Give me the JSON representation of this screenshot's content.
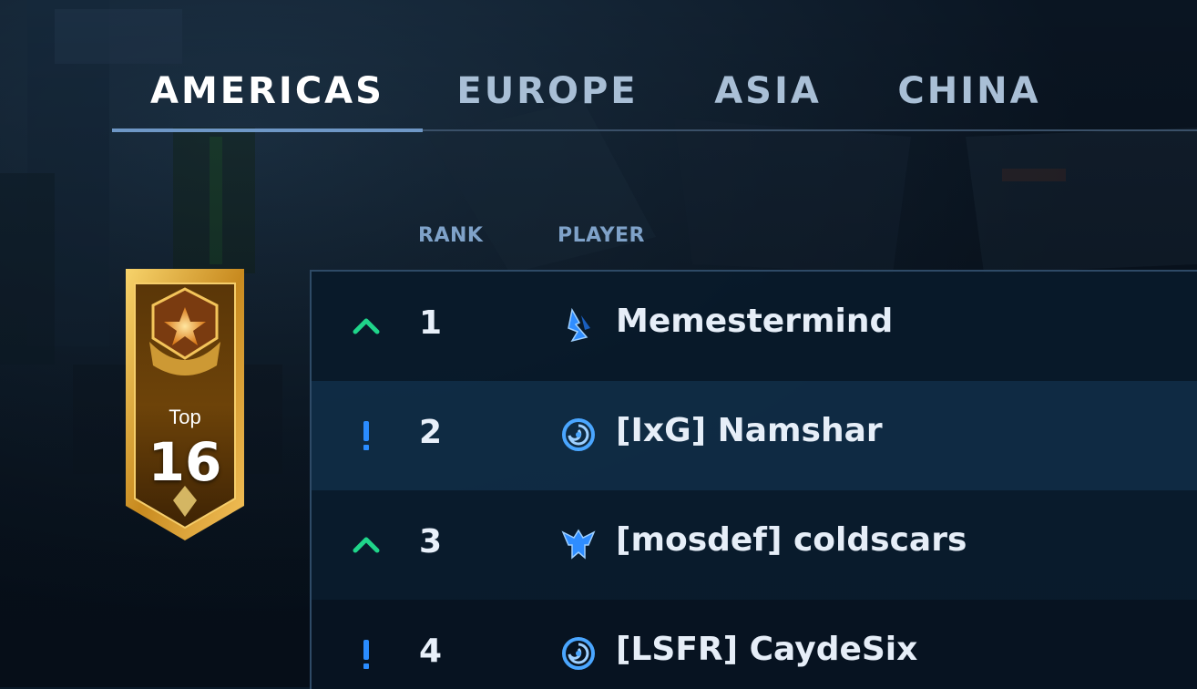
{
  "tabs": [
    {
      "label": "AMERICAS",
      "active": true
    },
    {
      "label": "EUROPE",
      "active": false
    },
    {
      "label": "ASIA",
      "active": false
    },
    {
      "label": "CHINA",
      "active": false
    }
  ],
  "columns": {
    "rank": "RANK",
    "player": "PLAYER"
  },
  "badge": {
    "label": "Top",
    "value": "16"
  },
  "rows": [
    {
      "trend": "up",
      "rank": "1",
      "race": "protoss",
      "player": "Memestermind"
    },
    {
      "trend": "new",
      "rank": "2",
      "race": "zerg",
      "player": "[IxG] Namshar"
    },
    {
      "trend": "up",
      "rank": "3",
      "race": "terran",
      "player": "[mosdef] coldscars"
    },
    {
      "trend": "new",
      "rank": "4",
      "race": "zerg",
      "player": "[LSFR] CaydeSix"
    }
  ],
  "colors": {
    "up": "#1fd58a",
    "new": "#2a8cff",
    "accent": "#6e97c6"
  }
}
